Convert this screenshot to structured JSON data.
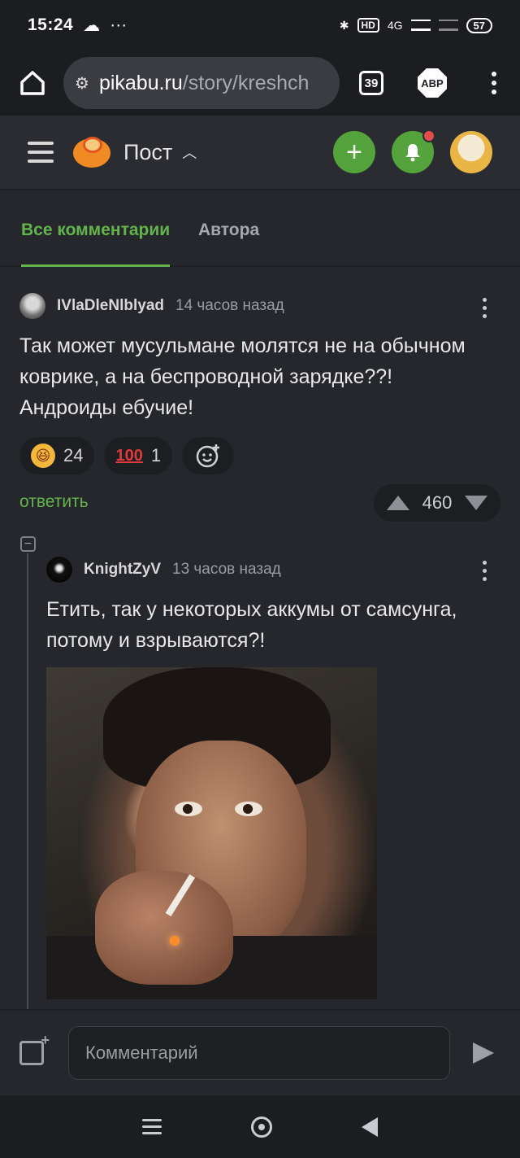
{
  "status": {
    "time": "15:24",
    "network": "4G",
    "hd": "HD",
    "battery": "57"
  },
  "browser": {
    "host": "pikabu.ru",
    "path": "/story/kreshch",
    "tabs_count": "39",
    "abp_label": "ABP"
  },
  "header": {
    "title": "Пост"
  },
  "tabs": {
    "all": "Все комментарии",
    "author": "Автора"
  },
  "comment1": {
    "user": "IVlaDleNlblyad",
    "time": "14 часов назад",
    "text_line1": "Так может мусульмане молятся не на обычном",
    "text_line2": "коврике, а на беспроводной зарядке??!",
    "text_line3": "Андроиды ебучие!",
    "reactions": [
      {
        "icon": "laughing-emoji-icon",
        "count": "24"
      },
      {
        "icon": "hundred-icon",
        "label": "100",
        "count": "1"
      }
    ],
    "reply_label": "ответить",
    "rating": "460"
  },
  "comment2": {
    "user": "KnightZyV",
    "time": "13 часов назад",
    "text_line1": "Етить, так у некоторых аккумы от самсунга,",
    "text_line2": "потому и взрываются?!"
  },
  "composer": {
    "placeholder": "Комментарий"
  },
  "colors": {
    "accent": "#62b44b",
    "background": "#25272c",
    "notif_dot": "#e24c4c"
  }
}
